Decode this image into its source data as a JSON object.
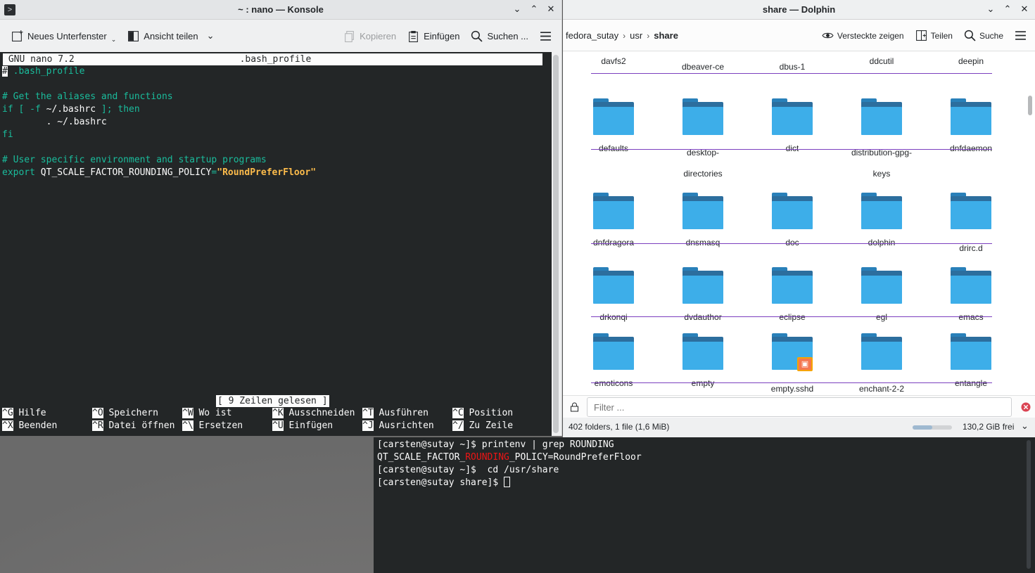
{
  "konsole": {
    "title": "~ : nano — Konsole",
    "toolbar": {
      "new_tab": "Neues Unterfenster",
      "split_view": "Ansicht teilen",
      "copy": "Kopieren",
      "paste": "Einfügen",
      "search": "Suchen ..."
    },
    "nano": {
      "version": "GNU nano 7.2",
      "filename": ".bash_profile",
      "lines": {
        "l1_cursor": "#",
        "l1_rest": " .bash_profile",
        "l3": "# Get the aliases and functions",
        "l4a": "if [ -f ",
        "l4b": "~/.bashrc",
        "l4c": " ]; then",
        "l5": "        . ~/.bashrc",
        "l6": "fi",
        "l8": "# User specific environment and startup programs",
        "l9a": "export",
        "l9b": " QT_SCALE_FACTOR_ROUNDING_POLICY",
        "l9c": "=",
        "l9d": "\"RoundPreferFloor\""
      },
      "status": "[ 9 Zeilen gelesen ]",
      "shortcuts": [
        {
          "key": "^G",
          "label": "Hilfe"
        },
        {
          "key": "^O",
          "label": "Speichern"
        },
        {
          "key": "^W",
          "label": "Wo ist"
        },
        {
          "key": "^K",
          "label": "Ausschneiden"
        },
        {
          "key": "^T",
          "label": "Ausführen"
        },
        {
          "key": "^C",
          "label": "Position"
        },
        {
          "key": "^X",
          "label": "Beenden"
        },
        {
          "key": "^R",
          "label": "Datei öffnen"
        },
        {
          "key": "^\\",
          "label": "Ersetzen"
        },
        {
          "key": "^U",
          "label": "Einfügen"
        },
        {
          "key": "^J",
          "label": "Ausrichten"
        },
        {
          "key": "^/",
          "label": "Zu Zeile"
        }
      ]
    }
  },
  "dolphin": {
    "title": "share — Dolphin",
    "breadcrumb": [
      "fedora_sutay",
      "usr",
      "share"
    ],
    "toolbar": {
      "show_hidden": "Versteckte zeigen",
      "split": "Teilen",
      "search": "Suche"
    },
    "folders": [
      {
        "name": "davfs2"
      },
      {
        "name": "dbeaver-ce"
      },
      {
        "name": "dbus-1"
      },
      {
        "name": "ddcutil"
      },
      {
        "name": "deepin"
      },
      {
        "name": "defaults"
      },
      {
        "name": "desktop-directories"
      },
      {
        "name": "dict"
      },
      {
        "name": "distribution-gpg-keys"
      },
      {
        "name": "dnfdaemon"
      },
      {
        "name": "dnfdragora"
      },
      {
        "name": "dnsmasq"
      },
      {
        "name": "doc"
      },
      {
        "name": "dolphin"
      },
      {
        "name": "drirc.d"
      },
      {
        "name": "drkonqi"
      },
      {
        "name": "dvdauthor"
      },
      {
        "name": "eclipse"
      },
      {
        "name": "egl"
      },
      {
        "name": "emacs"
      },
      {
        "name": "emoticons"
      },
      {
        "name": "empty"
      },
      {
        "name": "empty.sshd"
      },
      {
        "name": "enchant-2-2"
      },
      {
        "name": "entangle"
      }
    ],
    "filter_placeholder": "Filter ...",
    "status_text": "402 folders, 1 file (1,6 MiB)",
    "free_space": "130,2 GiB frei",
    "disk_usage_fraction": 0.5
  },
  "terminal": {
    "line1": "[carsten@sutay ~]$ printenv | grep ROUNDING",
    "line2a": "QT_SCALE_FACTOR_",
    "line2b": "ROUNDING",
    "line2c": "_POLICY=RoundPreferFloor",
    "line3": "[carsten@sutay ~]$  cd /usr/share",
    "line4": "[carsten@sutay share]$ "
  }
}
